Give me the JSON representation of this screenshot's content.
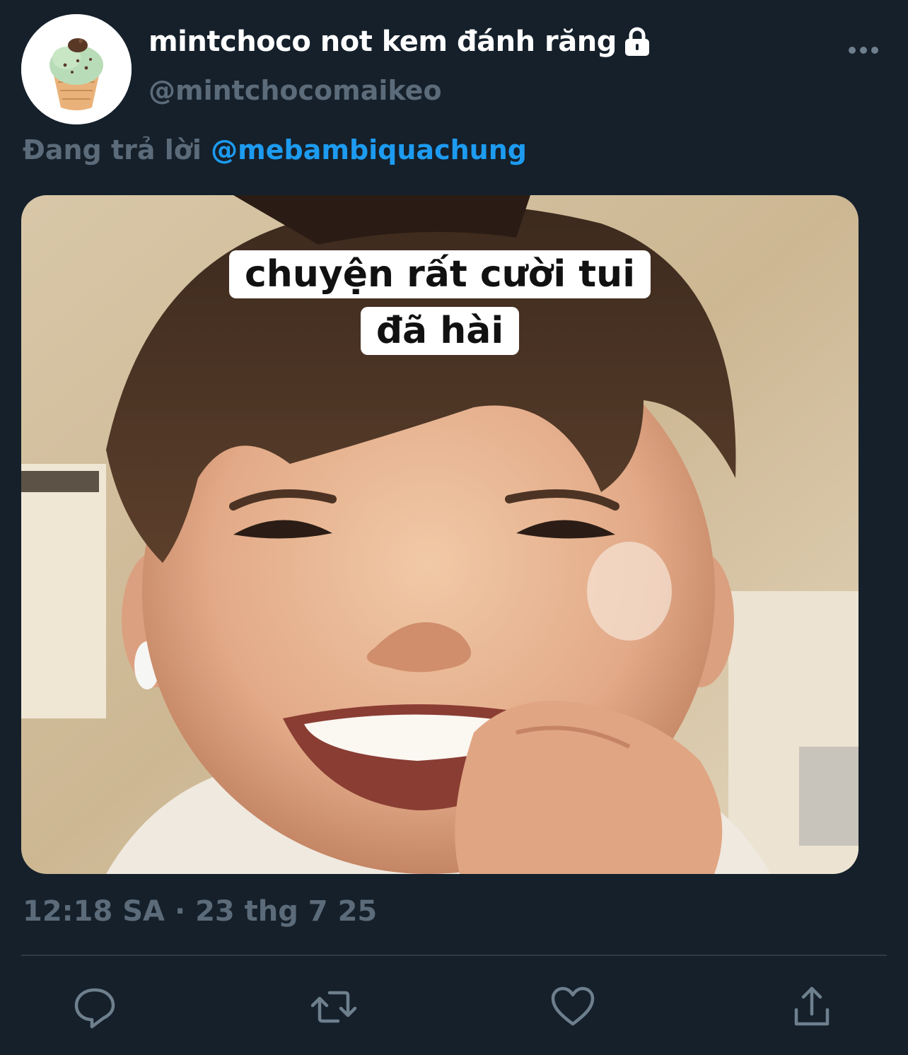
{
  "tweet": {
    "display_name": "mintchoco not kem đánh răng",
    "handle": "@mintchocomaikeo",
    "reply_prefix": "Đang trả lời",
    "reply_to": "@mebambiquachung",
    "media_caption": "chuyện rất cười tui đã hài",
    "timestamp": "12:18 SA · 23 thg 7 25"
  },
  "icons": {
    "avatar": "mint-choco-ice-cream-icon",
    "lock": "lock-icon",
    "more": "more-icon",
    "reply": "reply-icon",
    "retweet": "retweet-icon",
    "like": "heart-icon",
    "share": "share-icon"
  },
  "colors": {
    "background": "#15202b",
    "primary_text": "#ffffff",
    "secondary_text": "#5c6b79",
    "accent": "#1d9bf0",
    "divider": "#2f3b47"
  }
}
